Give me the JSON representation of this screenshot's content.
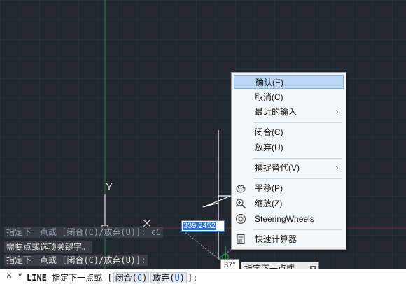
{
  "history": [
    "指定下一点或 [闭合(C)/放弃(U)]: cC",
    "需要点或选项关键字。",
    "指定下一点或 [闭合(C)/放弃(U)]:"
  ],
  "command_line": {
    "command": "LINE",
    "prompt": "指定下一点或 [",
    "options": [
      {
        "label": "闭合(",
        "key": "C",
        "end": ")"
      },
      {
        "label": "放弃(",
        "key": "U",
        "end": ")"
      }
    ],
    "suffix": "]:"
  },
  "ucs": {
    "y_label": "Y"
  },
  "dynamic_input": {
    "length_value": "339.2452",
    "angle_value": "37°",
    "prompt": "指定下一点或"
  },
  "context_menu": {
    "items": [
      {
        "label": "确认(E)"
      },
      {
        "label": "取消(C)"
      },
      {
        "label": "最近的输入"
      },
      {
        "label": "闭合(C)"
      },
      {
        "label": "放弃(U)"
      },
      {
        "label": "捕捉替代(V)"
      },
      {
        "label": "平移(P)",
        "icon": "pan-hand-icon"
      },
      {
        "label": "缩放(Z)",
        "icon": "zoom-icon"
      },
      {
        "label": "SteeringWheels",
        "icon": "steering-wheel-icon"
      },
      {
        "label": "快速计算器",
        "icon": "calculator-icon"
      }
    ]
  },
  "colors": {
    "background": "#212830",
    "grid_major": "#2c343d",
    "y_axis": "#2f7a3a",
    "x_axis": "#7a2e2e",
    "drawing_line": "#ffffff",
    "highlight": "#bcd7f4",
    "selection": "#2f6fd2"
  }
}
